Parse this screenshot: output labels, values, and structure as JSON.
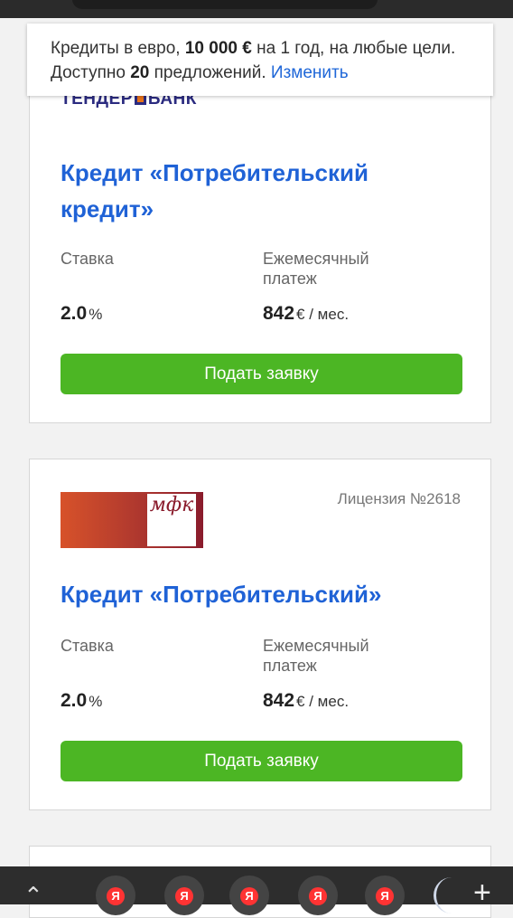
{
  "summary": {
    "line1_a": "Кредиты в евро, ",
    "line1_amount": "10 000 €",
    "line1_b": " на 1 год, на любые цели.",
    "line2_a": "Доступно ",
    "line2_count": "20",
    "line2_b": " предложений. ",
    "change_link": "Изменить"
  },
  "offers": [
    {
      "bank_logo_text_a": "ТЕНДЕР",
      "bank_logo_text_b": "БАНК",
      "title_line1": "Кредит «Потребительский",
      "title_line2": "кредит»",
      "rate_label": "Ставка",
      "payment_label_line1": "Ежемесячный",
      "payment_label_line2": "платеж",
      "rate_value": "2.0",
      "rate_unit": "%",
      "payment_value": "842",
      "payment_unit": "€ / мес.",
      "apply_button": "Подать заявку"
    },
    {
      "bank_logo_text": "мфк",
      "license": "Лицензия №2618",
      "title_line1": "Кредит «Потребительский»",
      "rate_label": "Ставка",
      "payment_label_line1": "Ежемесячный",
      "payment_label_line2": "платеж",
      "rate_value": "2.0",
      "rate_unit": "%",
      "payment_value": "842",
      "payment_unit": "€ / мес.",
      "apply_button": "Подать заявку"
    }
  ],
  "browser_bar": {
    "tab_icon_letter": "Я",
    "tab_count_visible": 5
  },
  "colors": {
    "link": "#1f67d8",
    "title": "#1f62d6",
    "button": "#4cb624"
  }
}
